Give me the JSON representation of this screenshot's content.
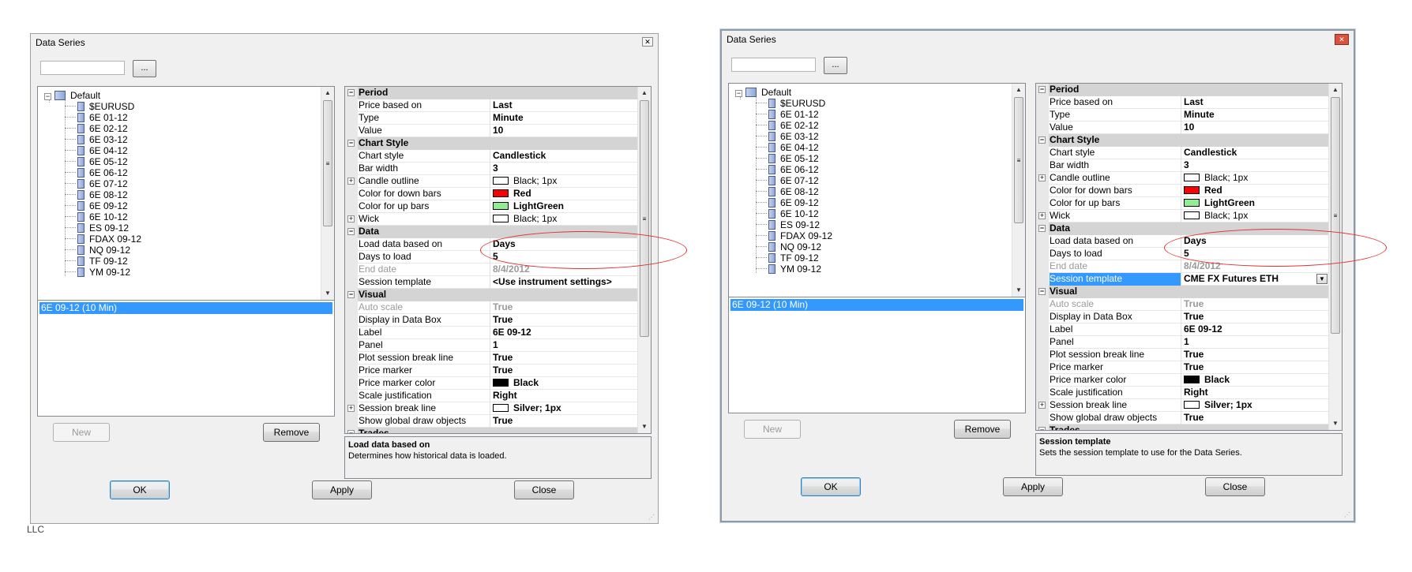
{
  "dialogs": [
    {
      "title": "Data Series",
      "browse_label": "...",
      "search_value": "",
      "tree": {
        "root": "Default",
        "items": [
          "$EURUSD",
          "6E 01-12",
          "6E 02-12",
          "6E 03-12",
          "6E 04-12",
          "6E 05-12",
          "6E 06-12",
          "6E 07-12",
          "6E 08-12",
          "6E 09-12",
          "6E 10-12",
          "ES 09-12",
          "FDAX 09-12",
          "NQ 09-12",
          "TF 09-12",
          "YM 09-12"
        ]
      },
      "selected_series": "6E 09-12 (10 Min)",
      "buttons": {
        "new": "New",
        "remove": "Remove",
        "ok": "OK",
        "apply": "Apply",
        "close": "Close"
      },
      "properties": {
        "period_label": "Period",
        "price_based_on": {
          "name": "Price based on",
          "value": "Last"
        },
        "type": {
          "name": "Type",
          "value": "Minute"
        },
        "value": {
          "name": "Value",
          "value": "10"
        },
        "chart_style_label": "Chart Style",
        "chart_style": {
          "name": "Chart style",
          "value": "Candlestick"
        },
        "bar_width": {
          "name": "Bar width",
          "value": "3"
        },
        "candle_outline": {
          "name": "Candle outline",
          "value": "Black; 1px"
        },
        "color_down": {
          "name": "Color for down bars",
          "value": "Red",
          "color": "#ff0000"
        },
        "color_up": {
          "name": "Color for up bars",
          "value": "LightGreen",
          "color": "#90ee90"
        },
        "wick": {
          "name": "Wick",
          "value": "Black; 1px"
        },
        "data_label": "Data",
        "load_data": {
          "name": "Load data based on",
          "value": "Days"
        },
        "days_to_load": {
          "name": "Days to load",
          "value": "5"
        },
        "end_date": {
          "name": "End date",
          "value": "8/4/2012"
        },
        "session_template": {
          "name": "Session template",
          "value": "<Use instrument settings>"
        },
        "visual_label": "Visual",
        "auto_scale": {
          "name": "Auto scale",
          "value": "True"
        },
        "display_data_box": {
          "name": "Display in Data Box",
          "value": "True"
        },
        "label": {
          "name": "Label",
          "value": "6E 09-12"
        },
        "panel": {
          "name": "Panel",
          "value": "1"
        },
        "plot_session_break": {
          "name": "Plot session break line",
          "value": "True"
        },
        "price_marker": {
          "name": "Price marker",
          "value": "True"
        },
        "price_marker_color": {
          "name": "Price marker color",
          "value": "Black",
          "color": "#000000"
        },
        "scale_justification": {
          "name": "Scale justification",
          "value": "Right"
        },
        "session_break_line": {
          "name": "Session break line",
          "value": "Silver; 1px"
        },
        "show_global_draw": {
          "name": "Show global draw objects",
          "value": "True"
        },
        "trades_label": "Trades"
      },
      "description": {
        "title": "Load data based on",
        "text": "Determines how historical data is loaded."
      }
    },
    {
      "title": "Data Series",
      "browse_label": "...",
      "search_value": "",
      "tree": {
        "root": "Default",
        "items": [
          "$EURUSD",
          "6E 01-12",
          "6E 02-12",
          "6E 03-12",
          "6E 04-12",
          "6E 05-12",
          "6E 06-12",
          "6E 07-12",
          "6E 08-12",
          "6E 09-12",
          "6E 10-12",
          "ES 09-12",
          "FDAX 09-12",
          "NQ 09-12",
          "TF 09-12",
          "YM 09-12"
        ]
      },
      "selected_series": "6E 09-12 (10 Min)",
      "buttons": {
        "new": "New",
        "remove": "Remove",
        "ok": "OK",
        "apply": "Apply",
        "close": "Close"
      },
      "properties": {
        "period_label": "Period",
        "price_based_on": {
          "name": "Price based on",
          "value": "Last"
        },
        "type": {
          "name": "Type",
          "value": "Minute"
        },
        "value": {
          "name": "Value",
          "value": "10"
        },
        "chart_style_label": "Chart Style",
        "chart_style": {
          "name": "Chart style",
          "value": "Candlestick"
        },
        "bar_width": {
          "name": "Bar width",
          "value": "3"
        },
        "candle_outline": {
          "name": "Candle outline",
          "value": "Black; 1px"
        },
        "color_down": {
          "name": "Color for down bars",
          "value": "Red",
          "color": "#ff0000"
        },
        "color_up": {
          "name": "Color for up bars",
          "value": "LightGreen",
          "color": "#90ee90"
        },
        "wick": {
          "name": "Wick",
          "value": "Black; 1px"
        },
        "data_label": "Data",
        "load_data": {
          "name": "Load data based on",
          "value": "Days"
        },
        "days_to_load": {
          "name": "Days to load",
          "value": "5"
        },
        "end_date": {
          "name": "End date",
          "value": "8/4/2012"
        },
        "session_template": {
          "name": "Session template",
          "value": "CME FX Futures ETH"
        },
        "visual_label": "Visual",
        "auto_scale": {
          "name": "Auto scale",
          "value": "True"
        },
        "display_data_box": {
          "name": "Display in Data Box",
          "value": "True"
        },
        "label": {
          "name": "Label",
          "value": "6E 09-12"
        },
        "panel": {
          "name": "Panel",
          "value": "1"
        },
        "plot_session_break": {
          "name": "Plot session break line",
          "value": "True"
        },
        "price_marker": {
          "name": "Price marker",
          "value": "True"
        },
        "price_marker_color": {
          "name": "Price marker color",
          "value": "Black",
          "color": "#000000"
        },
        "scale_justification": {
          "name": "Scale justification",
          "value": "Right"
        },
        "session_break_line": {
          "name": "Session break line",
          "value": "Silver; 1px"
        },
        "show_global_draw": {
          "name": "Show global draw objects",
          "value": "True"
        },
        "trades_label": "Trades"
      },
      "description": {
        "title": "Session template",
        "text": "Sets the session template to use for the Data Series."
      }
    }
  ],
  "background_text": "LLC",
  "accent_color": "#3399ff",
  "annotation_color": "#e03030"
}
